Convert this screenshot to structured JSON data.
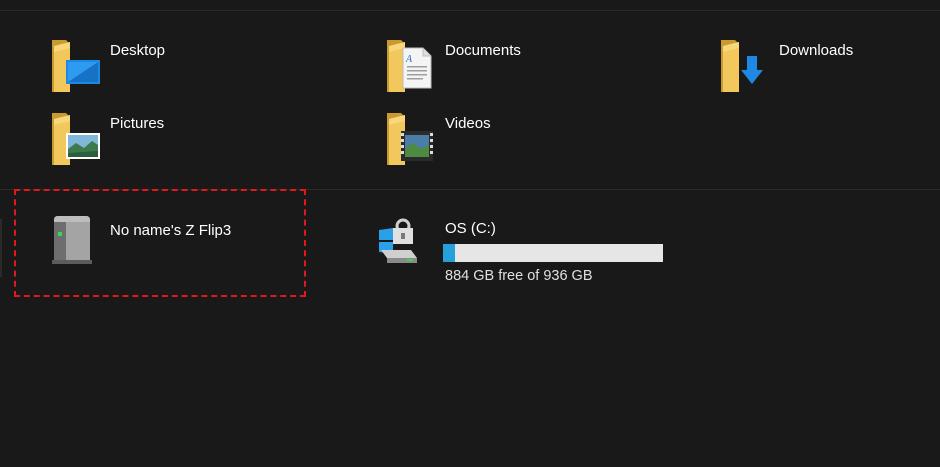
{
  "folders": [
    {
      "label": "Desktop",
      "icon": "desktop-folder-icon"
    },
    {
      "label": "Documents",
      "icon": "documents-folder-icon"
    },
    {
      "label": "Downloads",
      "icon": "downloads-folder-icon"
    },
    {
      "label": "Pictures",
      "icon": "pictures-folder-icon"
    },
    {
      "label": "Videos",
      "icon": "videos-folder-icon"
    }
  ],
  "devices": {
    "phone": {
      "label": "No name's Z Flip3",
      "icon": "portable-device-icon"
    },
    "os_drive": {
      "label": "OS (C:)",
      "free_text": "884 GB free of 936 GB",
      "used_fraction": 0.056,
      "icon": "windows-drive-lock-icon"
    }
  },
  "colors": {
    "background": "#191919",
    "folder": "#e8b43c",
    "bar_fill": "#26a0da",
    "bar_track": "#e6e6e6",
    "highlight": "#e01a1a"
  }
}
